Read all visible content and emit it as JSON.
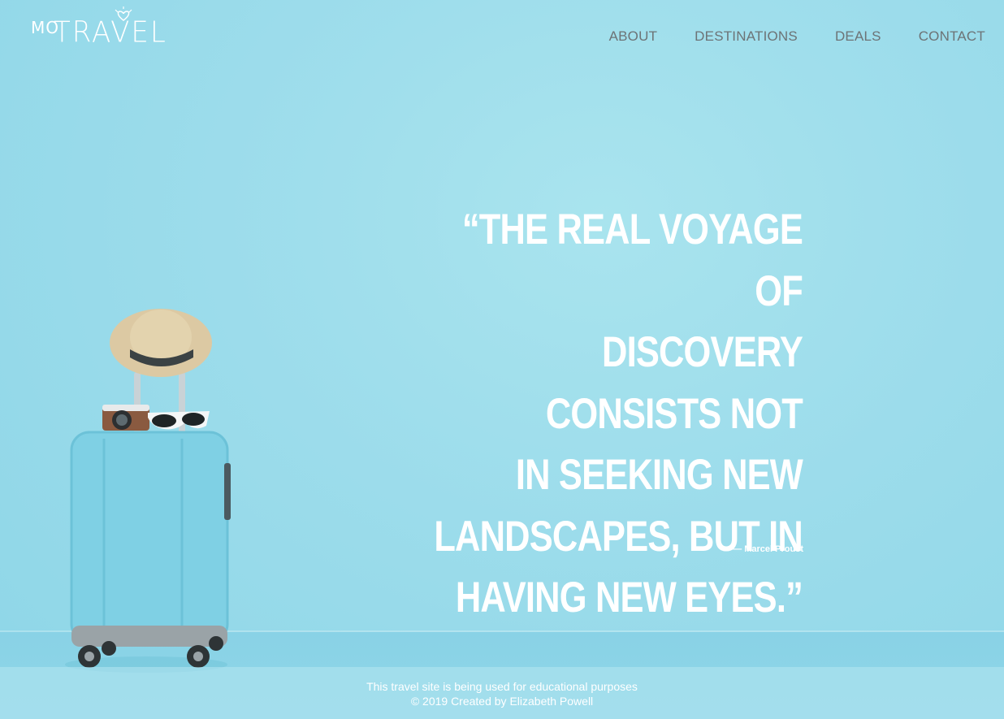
{
  "logo": {
    "mo": "MO",
    "travel": "TRAVEL"
  },
  "nav": {
    "items": [
      {
        "label": "ABOUT"
      },
      {
        "label": "DESTINATIONS"
      },
      {
        "label": "DEALS"
      },
      {
        "label": "CONTACT"
      }
    ]
  },
  "hero": {
    "quote_lines": [
      "“THE REAL VOYAGE OF",
      "DISCOVERY CONSISTS NOT",
      "IN SEEKING NEW",
      "LANDSCAPES, BUT IN",
      "HAVING NEW EYES.”"
    ],
    "author": "— Marcel Proust"
  },
  "footer": {
    "line1": "This travel site is being used for educational purposes",
    "line2": "© 2019 Created by Elizabeth Powell"
  },
  "colors": {
    "background": "#9fdcea",
    "nav_text": "#6d7376",
    "quote_text": "#ffffff"
  }
}
